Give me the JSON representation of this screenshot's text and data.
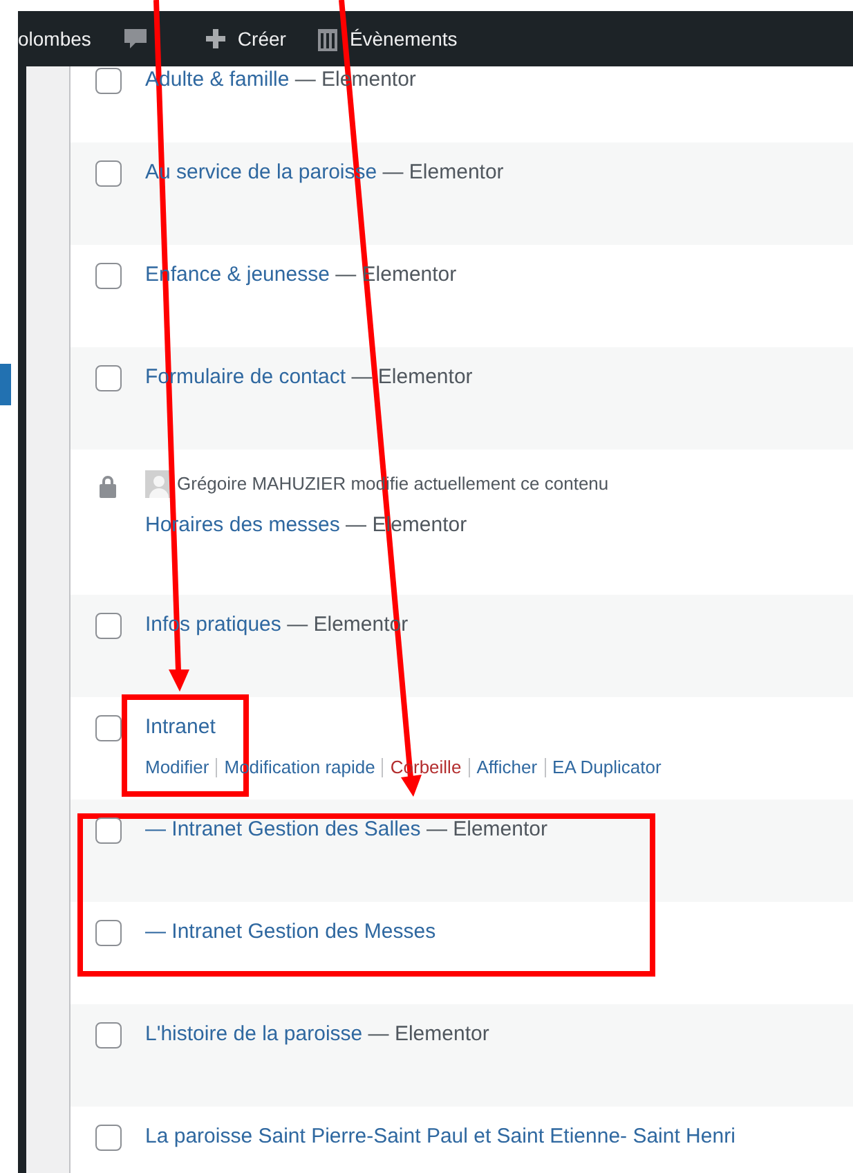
{
  "admin_bar": {
    "site_name": "olombes",
    "new_label": "Créer",
    "events_label": "Évènements"
  },
  "rows": [
    {
      "kind": "checkbox",
      "checked": false,
      "title": "Adulte & famille",
      "suffix": " — Elementor"
    },
    {
      "kind": "checkbox",
      "checked": false,
      "title": "Au service de la paroisse",
      "suffix": " — Elementor"
    },
    {
      "kind": "checkbox",
      "checked": false,
      "title": "Enfance & jeunesse",
      "suffix": " — Elementor"
    },
    {
      "kind": "checkbox",
      "checked": false,
      "title": "Formulaire de contact",
      "suffix": " — Elementor"
    },
    {
      "kind": "locked",
      "lock_notice": "Grégoire MAHUZIER modifie actuellement ce contenu",
      "title": "Horaires des messes",
      "suffix": " — Elementor"
    },
    {
      "kind": "checkbox",
      "checked": false,
      "title": "Infos pratiques",
      "suffix": " — Elementor"
    },
    {
      "kind": "checkbox",
      "checked": false,
      "title": "Intranet",
      "actions": [
        {
          "kind": "link",
          "label": "Modifier"
        },
        {
          "kind": "link",
          "label": "Modification rapide"
        },
        {
          "kind": "trash",
          "label": "Corbeille"
        },
        {
          "kind": "link",
          "label": "Afficher"
        },
        {
          "kind": "link",
          "label": "EA Duplicator"
        }
      ]
    },
    {
      "kind": "checkbox",
      "checked": false,
      "title": "— Intranet Gestion des Salles",
      "suffix": " — Elementor"
    },
    {
      "kind": "checkbox",
      "checked": false,
      "title": "— Intranet Gestion des Messes"
    },
    {
      "kind": "checkbox",
      "checked": false,
      "title": "L'histoire de la paroisse",
      "suffix": " — Elementor"
    },
    {
      "kind": "checkbox",
      "checked": false,
      "title": "La paroisse Saint Pierre-Saint Paul et Saint Etienne- Saint Henri"
    }
  ]
}
